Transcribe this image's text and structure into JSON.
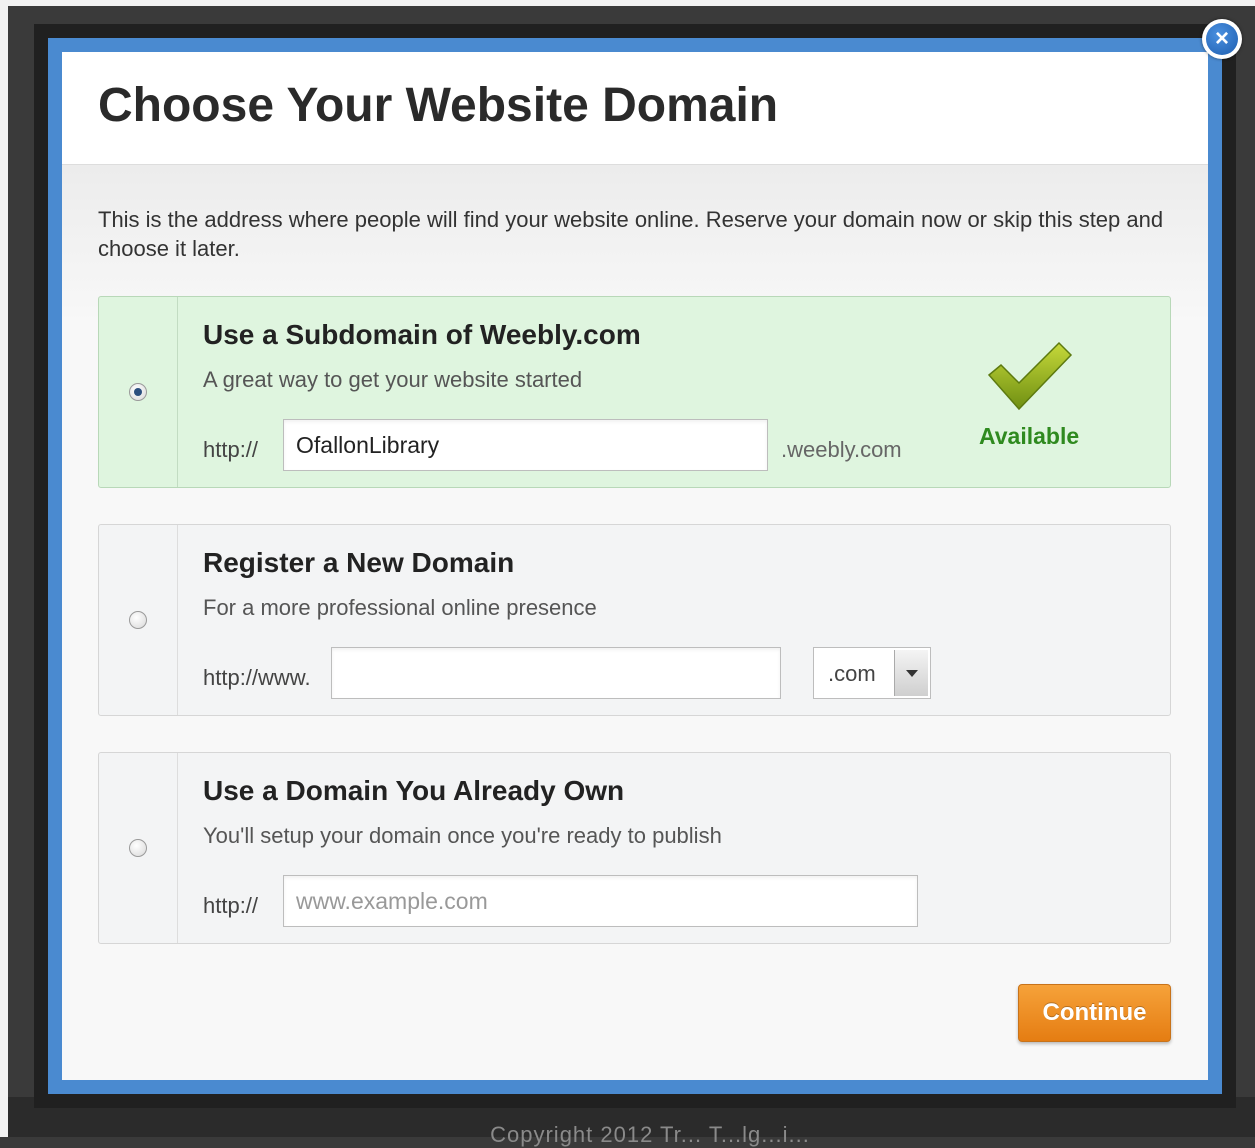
{
  "dialog": {
    "title": "Choose Your Website Domain",
    "intro": "This is the address where people will find your website online. Reserve your domain now or skip this step and choose it later.",
    "close_glyph": "×",
    "continue_label": "Continue"
  },
  "options": [
    {
      "title": "Use a Subdomain of Weebly.com",
      "subtitle": "A great way to get your website started",
      "prefix": "http://",
      "input_value": "OfallonLibrary",
      "suffix": ".weebly.com",
      "status": "Available",
      "selected": true
    },
    {
      "title": "Register a New Domain",
      "subtitle": "For a more professional online presence",
      "prefix": "http://www.",
      "input_value": "",
      "tld_selected": ".com",
      "selected": false
    },
    {
      "title": "Use a Domain You Already Own",
      "subtitle": "You'll setup your domain once you're ready to publish",
      "prefix": "http://",
      "input_value": "",
      "placeholder": "www.example.com",
      "selected": false
    }
  ],
  "footer": {
    "text": "Copyright 2012 Tr... T...lg...i..."
  },
  "colors": {
    "frame_blue": "#4a8ad0",
    "selected_bg": "#dff5df",
    "available_green": "#2f8a1f",
    "continue_orange": "#e57d12"
  },
  "icons": {
    "close": "close-icon",
    "available": "checkmark-icon",
    "dropdown": "chevron-down-icon"
  }
}
